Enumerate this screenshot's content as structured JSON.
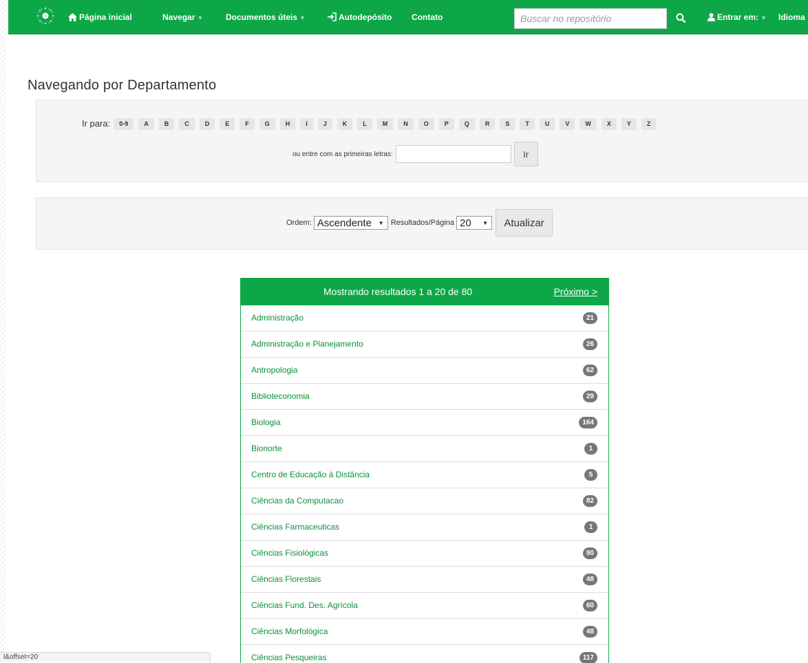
{
  "navbar": {
    "home": "Página inicial",
    "browse": "Navegar",
    "docs": "Documentos úteis",
    "selfdeposit": "Autodepósito",
    "contact": "Contato",
    "search_placeholder": "Buscar no repositório",
    "login": "Entrar em:",
    "language": "Idioma",
    "colors": {
      "bg": "#0ea747",
      "text": "#ffffff"
    }
  },
  "page": {
    "title": "Navegando por Departamento"
  },
  "jump": {
    "label": "Ir para:",
    "letters": [
      "0-9",
      "A",
      "B",
      "C",
      "D",
      "E",
      "F",
      "G",
      "H",
      "I",
      "J",
      "K",
      "L",
      "M",
      "N",
      "O",
      "P",
      "Q",
      "R",
      "S",
      "T",
      "U",
      "V",
      "W",
      "X",
      "Y",
      "Z"
    ],
    "starts_label": "ou entre com as primeiras letras:",
    "go_label": "Ir"
  },
  "order": {
    "order_label": "Ordem:",
    "order_value": "Ascendente",
    "rpp_label": "Resultados/Página",
    "rpp_value": "20",
    "update_label": "Atualizar"
  },
  "results": {
    "caption": "Mostrando resultados 1 a 20 de 80",
    "next_label": "Próximo >",
    "items": [
      {
        "name": "Administração",
        "count": "21"
      },
      {
        "name": "Administração e Planejamento",
        "count": "26"
      },
      {
        "name": "Antropologia",
        "count": "62"
      },
      {
        "name": "Biblioteconomia",
        "count": "29"
      },
      {
        "name": "Biologia",
        "count": "164"
      },
      {
        "name": "Bionorte",
        "count": "1"
      },
      {
        "name": "Centro de Educação à Distância",
        "count": "5"
      },
      {
        "name": "Ciências da Computacao",
        "count": "82"
      },
      {
        "name": "Ciências Farmaceuticas",
        "count": "1"
      },
      {
        "name": "Ciências Fisiológicas",
        "count": "90"
      },
      {
        "name": "Ciências Florestais",
        "count": "48"
      },
      {
        "name": "Ciências Fund. Des. Agrícola",
        "count": "60"
      },
      {
        "name": "Ciências Morfológica",
        "count": "48"
      },
      {
        "name": "Ciências Pesqueiras",
        "count": "117"
      }
    ]
  },
  "status_bar": {
    "url": "l&offset=20"
  }
}
